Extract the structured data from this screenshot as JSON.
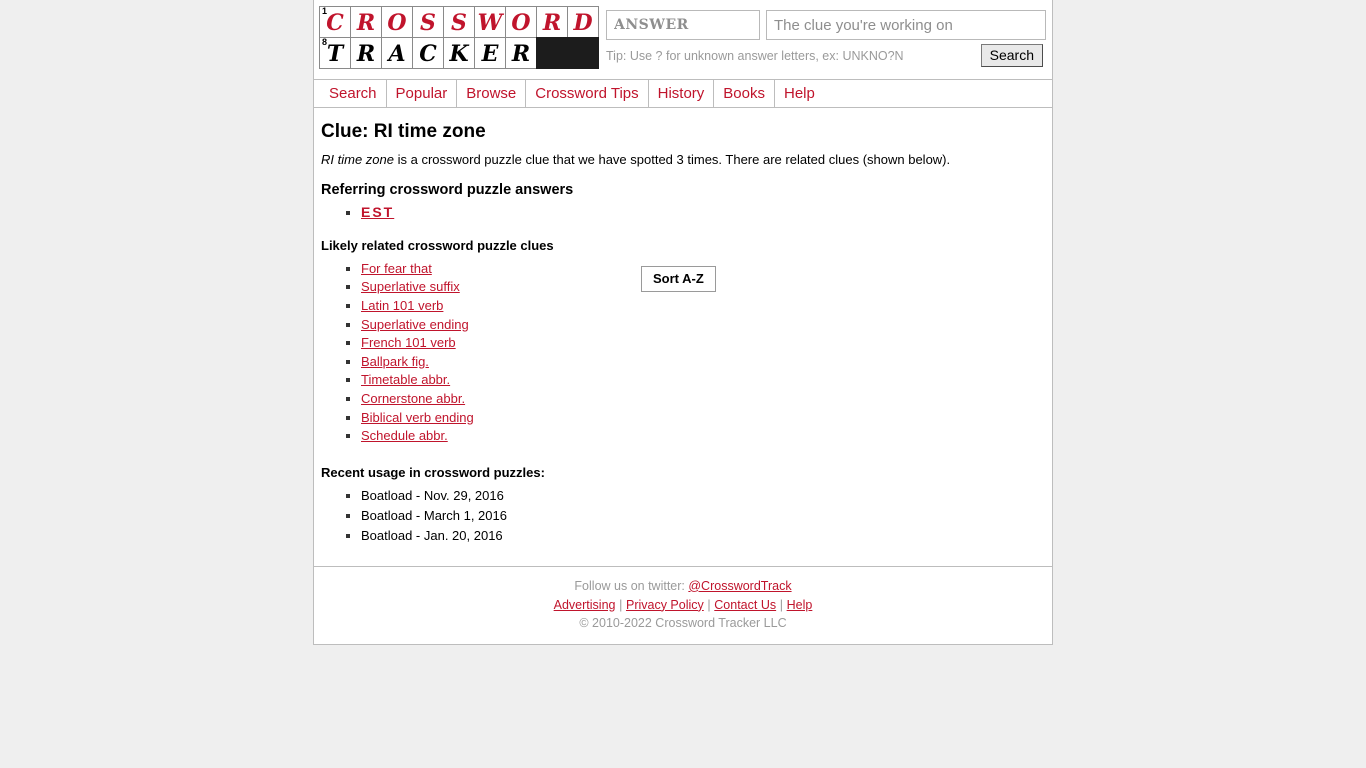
{
  "logo": {
    "row1": {
      "number": "1",
      "letters": [
        "C",
        "R",
        "O",
        "S",
        "S",
        "W",
        "O",
        "R",
        "D"
      ]
    },
    "row2": {
      "number": "8",
      "letters": [
        "T",
        "R",
        "A",
        "C",
        "K",
        "E",
        "R"
      ],
      "black_cells": 2
    },
    "letter_color": "#c0142c",
    "black_color": "#1c1c1c"
  },
  "search": {
    "answer_placeholder": "ANSWER",
    "answer_value": "",
    "clue_placeholder": "The clue you're working on",
    "clue_value": "",
    "tip": "Tip: Use ? for unknown answer letters, ex: UNKNO?N",
    "button_label": "Search"
  },
  "nav": {
    "items": [
      {
        "label": "Search"
      },
      {
        "label": "Popular"
      },
      {
        "label": "Browse"
      },
      {
        "label": "Crossword Tips"
      },
      {
        "label": "History"
      },
      {
        "label": "Books"
      },
      {
        "label": "Help"
      }
    ]
  },
  "main": {
    "title": "Clue: RI time zone",
    "lede_clue": "RI time zone",
    "lede_rest": " is a crossword puzzle clue that we have spotted 3 times. There are related clues (shown below).",
    "answers_heading": "Referring crossword puzzle answers",
    "answers": [
      {
        "label": "EST"
      }
    ],
    "related_heading": "Likely related crossword puzzle clues",
    "sort_button_label": "Sort A-Z",
    "related_clues": [
      {
        "label": "For fear that"
      },
      {
        "label": "Superlative suffix"
      },
      {
        "label": "Latin 101 verb"
      },
      {
        "label": "Superlative ending"
      },
      {
        "label": "French 101 verb"
      },
      {
        "label": "Ballpark fig."
      },
      {
        "label": "Timetable abbr."
      },
      {
        "label": "Cornerstone abbr."
      },
      {
        "label": "Biblical verb ending"
      },
      {
        "label": "Schedule abbr."
      }
    ],
    "usage_heading": "Recent usage in crossword puzzles:",
    "usage": [
      {
        "label": "Boatload - Nov. 29, 2016"
      },
      {
        "label": "Boatload - March 1, 2016"
      },
      {
        "label": "Boatload - Jan. 20, 2016"
      }
    ]
  },
  "footer": {
    "twitter_prefix": "Follow us on twitter: ",
    "twitter_handle": "@CrosswordTrack",
    "links": [
      {
        "label": "Advertising"
      },
      {
        "label": "Privacy Policy"
      },
      {
        "label": "Contact Us"
      },
      {
        "label": "Help"
      }
    ],
    "separator": "|",
    "copyright": "© 2010-2022 Crossword Tracker LLC"
  },
  "colors": {
    "brand_red": "#c0142c",
    "border_gray": "#bdbdbd",
    "muted_gray": "#9a9a9a"
  }
}
